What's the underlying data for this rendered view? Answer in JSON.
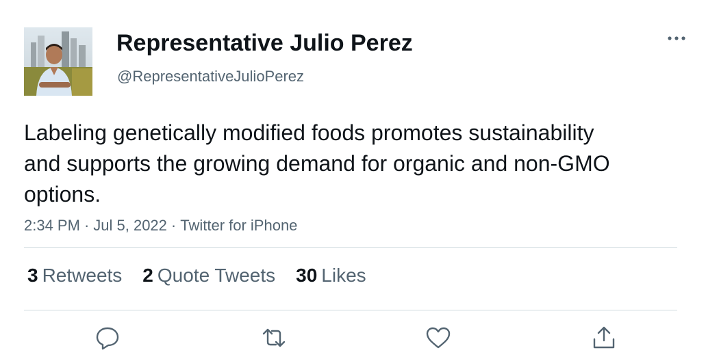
{
  "author": {
    "display_name": "Representative Julio Perez",
    "handle": "@RepresentativeJulioPerez"
  },
  "tweet": {
    "text": "Labeling genetically modified foods promotes sustainability and supports the growing demand for organic and non-GMO options.",
    "time": "2:34 PM",
    "date": "Jul 5, 2022",
    "source": "Twitter for iPhone",
    "separator": "·"
  },
  "stats": {
    "retweets": {
      "count": "3",
      "label": "Retweets"
    },
    "quote_tweets": {
      "count": "2",
      "label": "Quote Tweets"
    },
    "likes": {
      "count": "30",
      "label": "Likes"
    }
  },
  "icons": {
    "more": "more-horizontal-icon",
    "reply": "reply-icon",
    "retweet": "retweet-icon",
    "like": "heart-icon",
    "share": "share-icon"
  },
  "colors": {
    "text_primary": "#0f1419",
    "text_secondary": "#536471",
    "divider": "#cfd9de",
    "icon": "#536471"
  }
}
